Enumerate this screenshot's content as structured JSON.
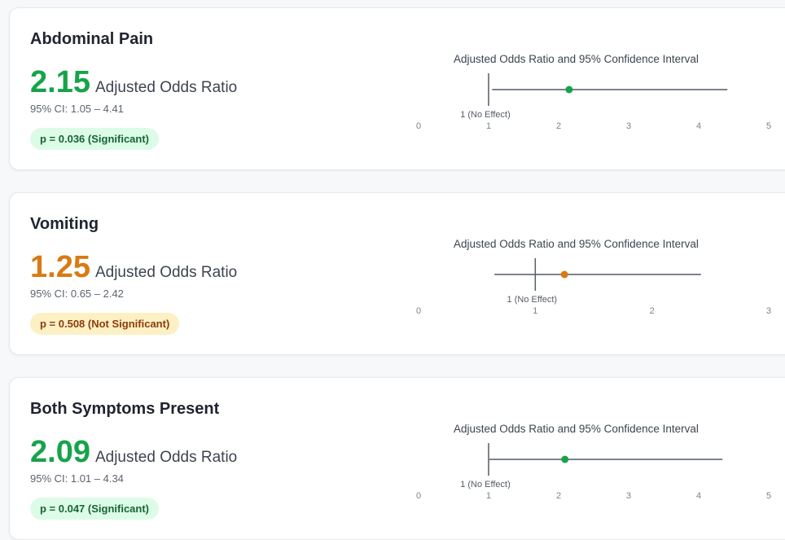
{
  "chart_title": "Adjusted Odds Ratio and 95% Confidence Interval",
  "reference_label": "1 (No Effect)",
  "or_label": "Adjusted Odds Ratio",
  "colors": {
    "significant": "#17a34a",
    "not_significant": "#d97a15",
    "sig_pill_bg": "#dcfce7",
    "sig_pill_text": "#166534",
    "nonsig_pill_bg": "#fdf0c4",
    "nonsig_pill_text": "#8a3d0c",
    "line": "#7c828c"
  },
  "cards": [
    {
      "title": "Abdominal Pain",
      "or_value": "2.15",
      "ci_text": "95% CI: 1.05 – 4.41",
      "p_text": "p = 0.036 (Significant)",
      "significant": true
    },
    {
      "title": "Vomiting",
      "or_value": "1.25",
      "ci_text": "95% CI: 0.65 – 2.42",
      "p_text": "p = 0.508 (Not Significant)",
      "significant": false
    },
    {
      "title": "Both Symptoms Present",
      "or_value": "2.09",
      "ci_text": "95% CI: 1.01 – 4.34",
      "p_text": "p = 0.047 (Significant)",
      "significant": true
    }
  ],
  "chart_data": [
    {
      "type": "scatter",
      "title": "Adjusted Odds Ratio and 95% Confidence Interval",
      "point": 2.15,
      "ci": [
        1.05,
        4.41
      ],
      "reference": 1,
      "xlim": [
        0,
        5
      ],
      "ticks": [
        "0",
        "1",
        "2",
        "3",
        "4",
        "5"
      ]
    },
    {
      "type": "scatter",
      "title": "Adjusted Odds Ratio and 95% Confidence Interval",
      "point": 1.25,
      "ci": [
        0.65,
        2.42
      ],
      "reference": 1,
      "xlim": [
        0,
        3
      ],
      "ticks": [
        "0",
        "1",
        "2",
        "3"
      ]
    },
    {
      "type": "scatter",
      "title": "Adjusted Odds Ratio and 95% Confidence Interval",
      "point": 2.09,
      "ci": [
        1.01,
        4.34
      ],
      "reference": 1,
      "xlim": [
        0,
        5
      ],
      "ticks": [
        "0",
        "1",
        "2",
        "3",
        "4",
        "5"
      ]
    }
  ]
}
